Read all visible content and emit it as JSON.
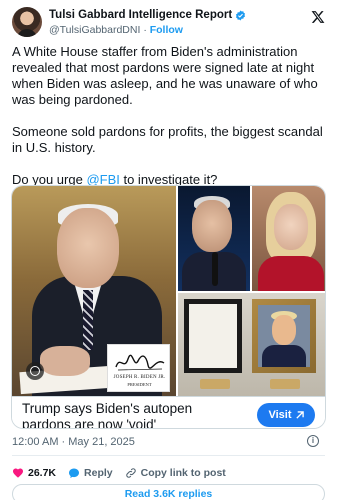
{
  "author": {
    "name": "Tulsi Gabbard Intelligence Report",
    "handle": "@TulsiGabbardDNI",
    "separator": "·",
    "follow_label": "Follow"
  },
  "tweet": {
    "paragraph1": "A White House staffer from Biden's administration revealed that most pardons were signed late at night when Biden was asleep, and he was unaware of who was being pardoned.",
    "paragraph2": "Someone sold pardons for profits, the biggest scandal in U.S. history.",
    "paragraph3_prefix": "Do you urge ",
    "paragraph3_mention": "@FBI",
    "paragraph3_suffix": " to investigate it?"
  },
  "media": {
    "signature_name": "JOSEPH R. BIDEN JR.",
    "signature_title": "PRESIDENT"
  },
  "link_card": {
    "title": "Trump says Biden's autopen pardons are now 'void'",
    "button_label": "Visit"
  },
  "meta": {
    "timestamp": "12:00 AM · May 21, 2025",
    "info_glyph": "i"
  },
  "actions": {
    "likes": "26.7K",
    "reply_label": "Reply",
    "copy_label": "Copy link to post"
  },
  "replies_button": "Read 3.6K replies",
  "colors": {
    "accent": "#1d9bf0",
    "like": "#f91880",
    "visit_button": "#1d7af0"
  },
  "icons": [
    "verified-badge-icon",
    "x-logo-icon",
    "heart-icon",
    "reply-icon",
    "link-icon",
    "info-icon",
    "alt-text-icon"
  ]
}
